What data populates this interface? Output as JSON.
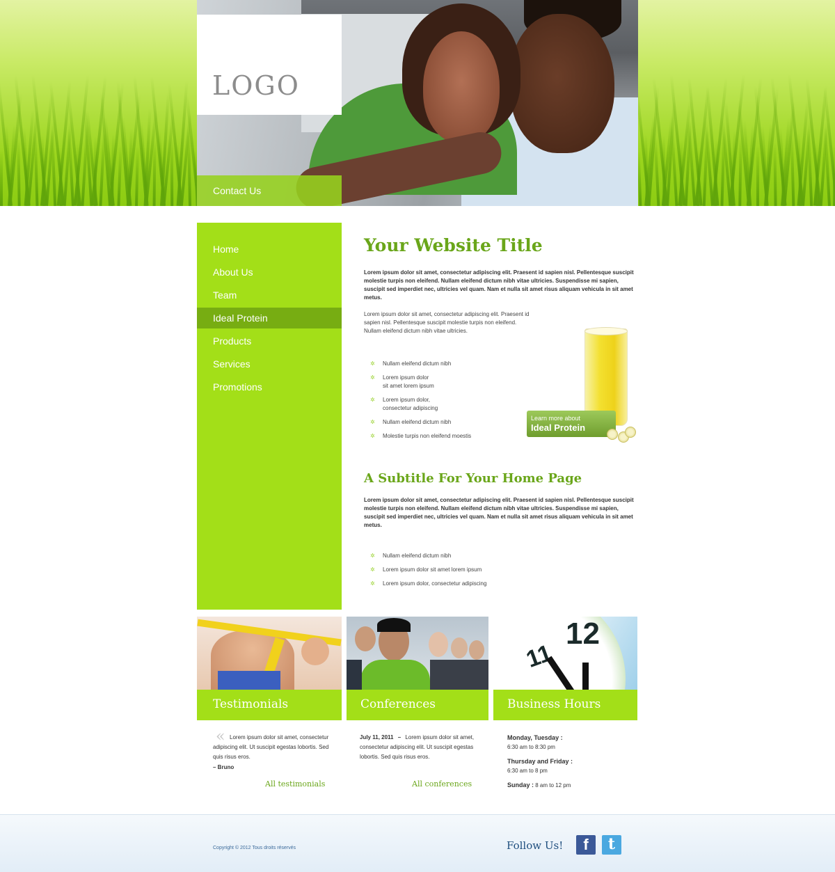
{
  "brand": {
    "logo_text": "LOGO",
    "accent": "#a3df18",
    "accent_dark": "#77ad12",
    "title_green": "#6aa61a"
  },
  "header": {
    "contact_label": "Contact Us"
  },
  "nav": {
    "items": [
      {
        "label": "Home"
      },
      {
        "label": "About Us"
      },
      {
        "label": "Team"
      },
      {
        "label": "Ideal Protein",
        "active": true
      },
      {
        "label": "Products"
      },
      {
        "label": "Services"
      },
      {
        "label": "Promotions"
      }
    ]
  },
  "main": {
    "title": "Your Website Title",
    "lead": "Lorem ipsum dolor sit amet, consectetur adipiscing elit. Praesent id sapien nisl. Pellentesque suscipit molestie turpis non eleifend. Nullam eleifend dictum nibh vitae ultricies. Suspendisse mi sapien, suscipit sed imperdiet nec, ultricies vel quam. Nam et nulla sit amet risus aliquam vehicula in sit amet metus.",
    "paragraph": "Lorem ipsum dolor sit amet, consectetur adipiscing elit. Praesent id sapien nisl. Pellentesque suscipit molestie turpis non eleifend. Nullam eleifend dictum nibh vitae ultricies.",
    "bullets": [
      {
        "line1": "Nullam eleifend dictum nibh",
        "line2": ""
      },
      {
        "line1": "Lorem ipsum dolor",
        "line2": "sit amet lorem ipsum"
      },
      {
        "line1": "Lorem ipsum dolor,",
        "line2": "consectetur adipiscing"
      },
      {
        "line1": "Nullam eleifend dictum nibh",
        "line2": ""
      },
      {
        "line1": "Molestie turpis non eleifend moestis",
        "line2": ""
      }
    ],
    "promo": {
      "small": "Learn more about",
      "big": "Ideal Protein"
    },
    "subtitle": "A Subtitle For Your Home Page",
    "lead2": "Lorem ipsum dolor sit amet, consectetur adipiscing elit. Praesent id sapien nisl. Pellentesque suscipit molestie turpis non eleifend. Nullam eleifend dictum nibh vitae ultricies. Suspendisse mi sapien, suscipit sed imperdiet nec, ultricies vel quam. Nam et nulla sit amet risus aliquam vehicula in sit amet metus.",
    "bullets2": [
      "Nullam eleifend dictum nibh",
      "Lorem ipsum dolor sit amet lorem ipsum",
      "Lorem ipsum dolor, consectetur adipiscing"
    ]
  },
  "features": {
    "testimonials": {
      "title": "Testimonials",
      "quote": "Lorem ipsum dolor sit amet, consectetur adipiscing elit. Ut suscipit egestas lobortis. Sed quis risus eros.",
      "author": "– Bruno",
      "link": "All testimonials"
    },
    "conferences": {
      "title": "Conferences",
      "date": "July 11, 2011",
      "dash": "–",
      "text": "Lorem ipsum dolor sit amet, consectetur adipiscing elit. Ut suscipit egestas lobortis. Sed quis risus eros.",
      "link": "All conferences"
    },
    "hours": {
      "title": "Business Hours",
      "clock_12": "12",
      "clock_11": "11",
      "rows": [
        {
          "days": "Monday, Tuesday :",
          "time": "6:30 am to 8:30 pm"
        },
        {
          "days": "Thursday and Friday :",
          "time": "6:30 am to 8 pm"
        }
      ],
      "sunday_label": "Sunday :",
      "sunday_time": "8 am to 12 pm"
    }
  },
  "footer": {
    "copyright": "Copyright © 2012 Tous droits réservés",
    "follow": "Follow Us!",
    "facebook_glyph": "f",
    "twitter_glyph": "t",
    "facebook_color": "#3b5998",
    "twitter_color": "#4aa8e0"
  }
}
